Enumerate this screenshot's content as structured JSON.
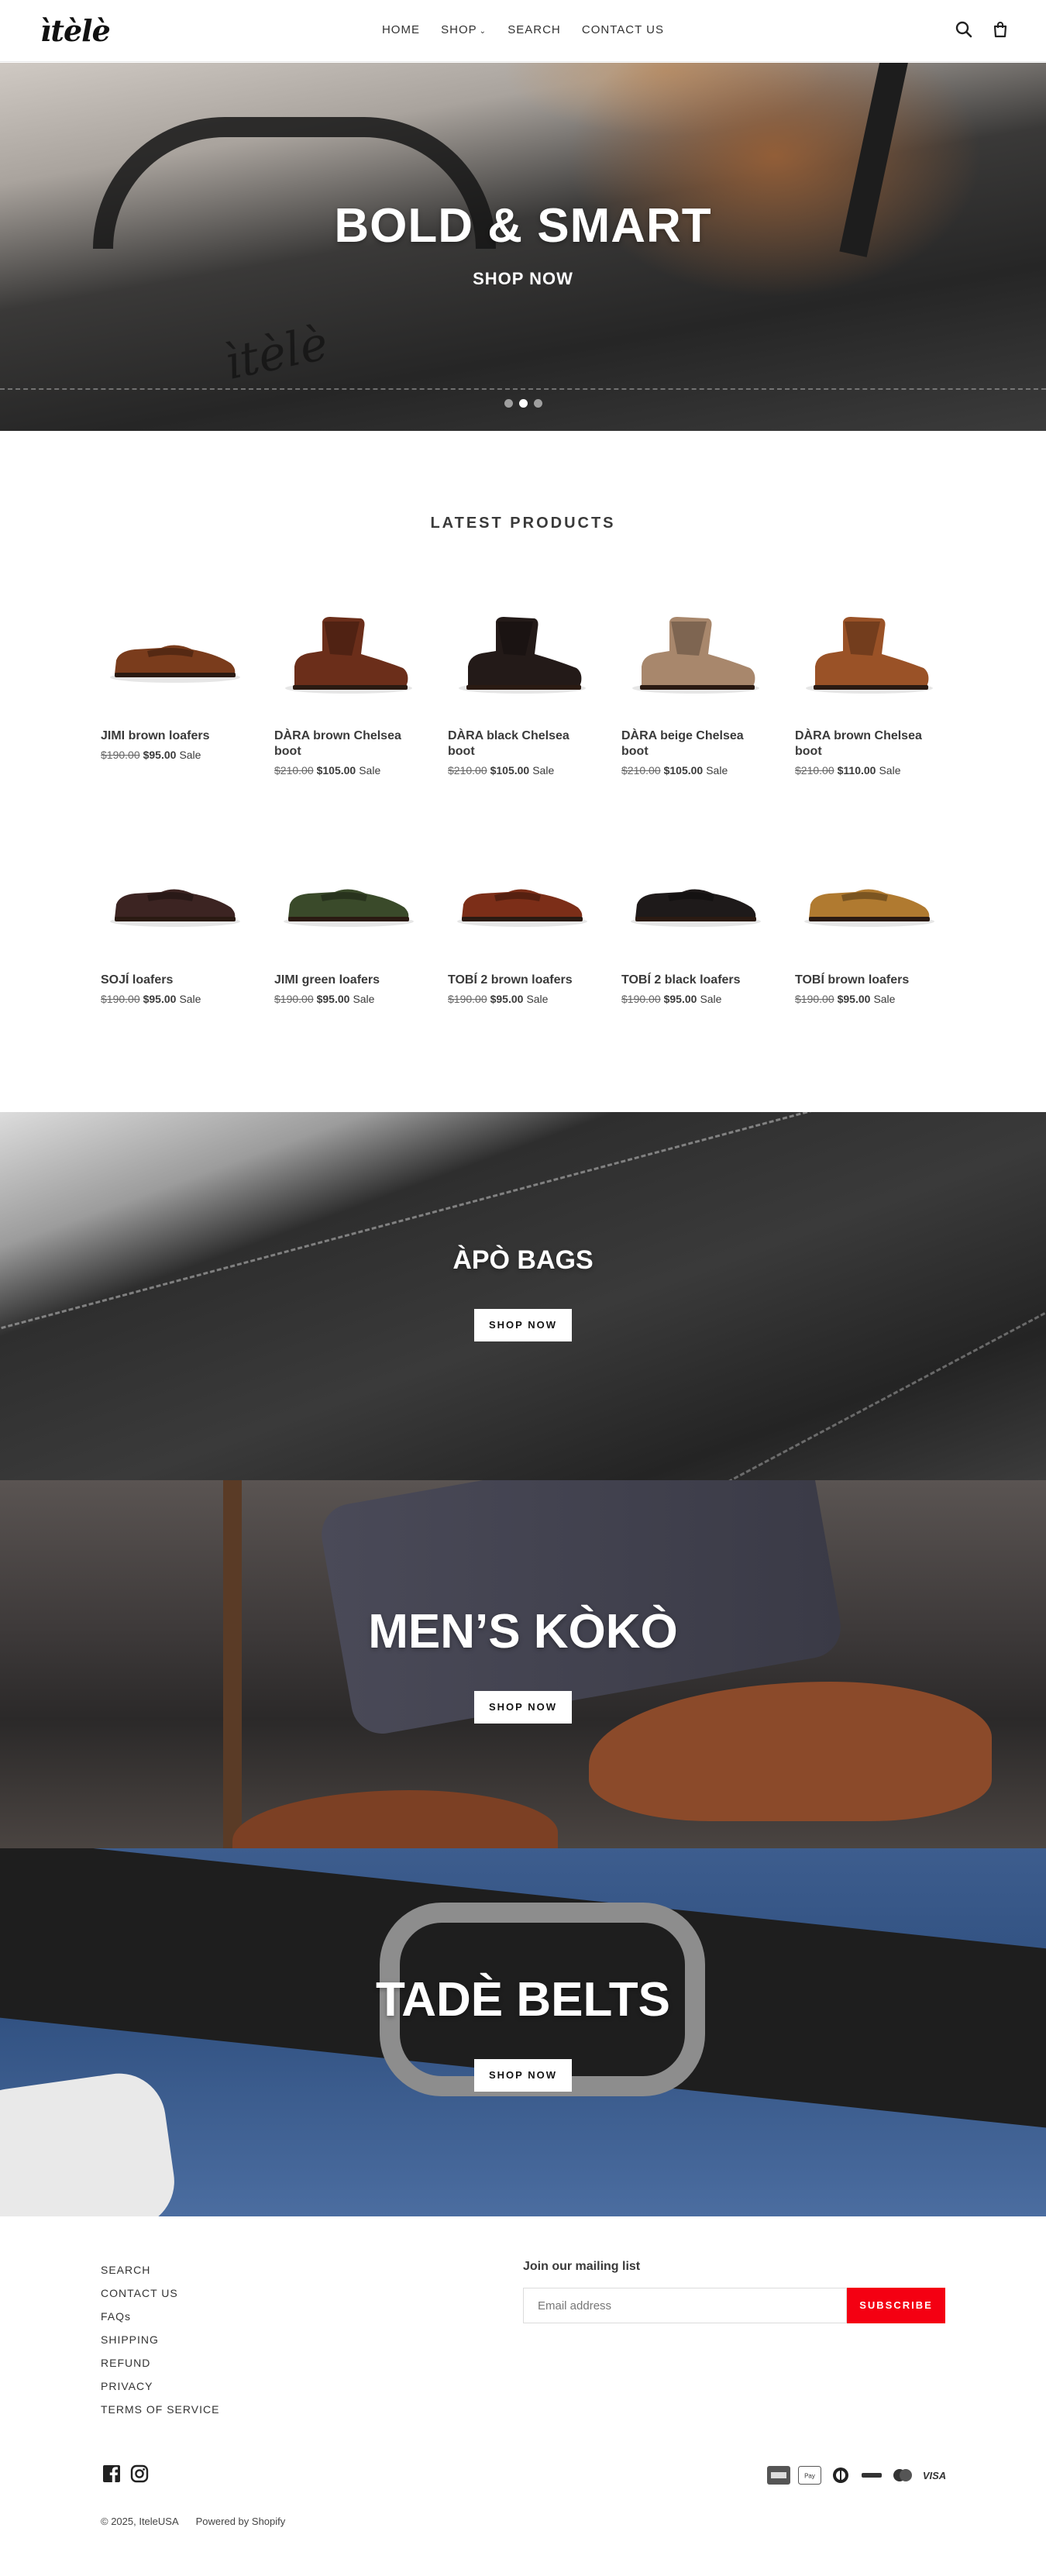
{
  "brand": {
    "logo_text": "ìtèlè"
  },
  "nav": {
    "items": [
      "HOME",
      "SHOP",
      "SEARCH",
      "CONTACT US"
    ]
  },
  "hero": {
    "title": "BOLD & SMART",
    "button": "SHOP NOW",
    "slides": 3,
    "active_slide": 2
  },
  "latest": {
    "title": "LATEST PRODUCTS",
    "products": [
      {
        "name": "JIMI brown loafers",
        "old_price": "$190.00",
        "price": "$95.00",
        "tag": "Sale",
        "color": "#7a3c1c",
        "style": "loafer"
      },
      {
        "name": "DÀRA brown Chelsea boot",
        "old_price": "$210.00",
        "price": "$105.00",
        "tag": "Sale",
        "color": "#6b2e1a",
        "style": "boot"
      },
      {
        "name": "DÀRA black Chelsea boot",
        "old_price": "$210.00",
        "price": "$105.00",
        "tag": "Sale",
        "color": "#231a18",
        "style": "boot"
      },
      {
        "name": "DÀRA beige Chelsea boot",
        "old_price": "$210.00",
        "price": "$105.00",
        "tag": "Sale",
        "color": "#a8876c",
        "style": "boot"
      },
      {
        "name": "DÀRA brown Chelsea boot",
        "old_price": "$210.00",
        "price": "$110.00",
        "tag": "Sale",
        "color": "#9a5227",
        "style": "boot"
      },
      {
        "name": "SOJÍ loafers",
        "old_price": "$190.00",
        "price": "$95.00",
        "tag": "Sale",
        "color": "#3c2422",
        "style": "loafer"
      },
      {
        "name": "JIMI green loafers",
        "old_price": "$190.00",
        "price": "$95.00",
        "tag": "Sale",
        "color": "#3a4a2a",
        "style": "loafer"
      },
      {
        "name": "TOBÍ 2 brown loafers",
        "old_price": "$190.00",
        "price": "$95.00",
        "tag": "Sale",
        "color": "#7c2e18",
        "style": "loafer"
      },
      {
        "name": "TOBÍ 2 black loafers",
        "old_price": "$190.00",
        "price": "$95.00",
        "tag": "Sale",
        "color": "#1e1a1a",
        "style": "loafer"
      },
      {
        "name": "TOBÍ brown loafers",
        "old_price": "$190.00",
        "price": "$95.00",
        "tag": "Sale",
        "color": "#b07a30",
        "style": "loafer"
      }
    ]
  },
  "banners": [
    {
      "title": "ÀPÒ BAGS",
      "button": "SHOP NOW"
    },
    {
      "title": "MEN’S KÒKÒ",
      "button": "SHOP NOW"
    },
    {
      "title": "TADÈ BELTS",
      "button": "SHOP NOW"
    }
  ],
  "footer": {
    "links": [
      "SEARCH",
      "CONTACT US",
      "FAQs",
      "SHIPPING",
      "REFUND",
      "PRIVACY",
      "TERMS OF SERVICE"
    ],
    "mailing_title": "Join our mailing list",
    "email_placeholder": "Email address",
    "subscribe": "SUBSCRIBE",
    "payment_icons": [
      "american-express-icon",
      "apple-pay-icon",
      "diners-club-icon",
      "discover-icon",
      "mastercard-icon",
      "visa-icon"
    ],
    "copyright": "© 2025, IteleUSA",
    "powered_by": "Powered by Shopify"
  },
  "colors": {
    "accent": "#f40012",
    "text": "#3a3a3a"
  }
}
